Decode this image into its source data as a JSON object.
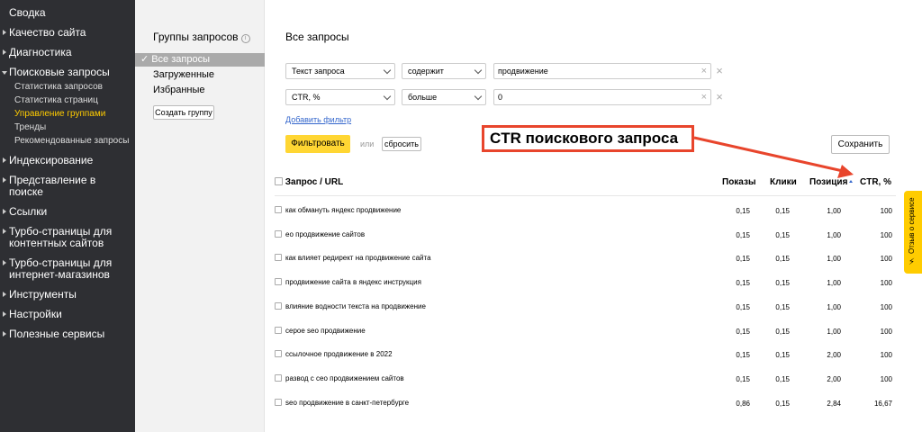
{
  "nav": {
    "items": [
      {
        "label": "Сводка",
        "arrow": false
      },
      {
        "label": "Качество сайта",
        "arrow": true
      },
      {
        "label": "Диагностика",
        "arrow": true
      },
      {
        "label": "Поисковые запросы",
        "arrow": true,
        "open": true
      }
    ],
    "sub_items": [
      {
        "label": "Статистика запросов",
        "active": false
      },
      {
        "label": "Статистика страниц",
        "active": false
      },
      {
        "label": "Управление группами",
        "active": true
      },
      {
        "label": "Тренды",
        "active": false
      },
      {
        "label": "Рекомендованные запросы",
        "active": false
      }
    ],
    "items_after": [
      {
        "label": "Индексирование"
      },
      {
        "label": "Представление в поиске"
      },
      {
        "label": "Ссылки"
      },
      {
        "label": "Турбо-страницы для контентных сайтов"
      },
      {
        "label": "Турбо-страницы для интернет-магазинов"
      },
      {
        "label": "Инструменты"
      },
      {
        "label": "Настройки"
      },
      {
        "label": "Полезные сервисы"
      }
    ]
  },
  "groups": {
    "title": "Группы запросов",
    "info_icon": "i",
    "items": [
      {
        "label": "Все запросы",
        "active": true
      },
      {
        "label": "Загруженные",
        "active": false
      },
      {
        "label": "Избранные",
        "active": false
      }
    ],
    "create_button": "Создать группу"
  },
  "main": {
    "title": "Все запросы",
    "filters": [
      {
        "field": "Текст запроса",
        "operator": "содержит",
        "value": "продвижение"
      },
      {
        "field": "CTR, %",
        "operator": "больше",
        "value": "0"
      }
    ],
    "add_filter": "Добавить фильтр",
    "apply_button": "Фильтровать",
    "or_label": "или",
    "reset_button": "сбросить",
    "save_button": "Сохранить"
  },
  "table": {
    "columns": {
      "query": "Запрос / URL",
      "shows": "Показы",
      "clicks": "Клики",
      "position": "Позиция",
      "ctr": "CTR, %"
    },
    "rows": [
      {
        "query": "как обмануть яндекс продвижение",
        "shows": "0,15",
        "clicks": "0,15",
        "position": "1,00",
        "ctr": "100"
      },
      {
        "query": "ео продвижение сайтов",
        "shows": "0,15",
        "clicks": "0,15",
        "position": "1,00",
        "ctr": "100"
      },
      {
        "query": "как влияет редирект на продвижение сайта",
        "shows": "0,15",
        "clicks": "0,15",
        "position": "1,00",
        "ctr": "100"
      },
      {
        "query": "продвижение сайта в яндекс инструкция",
        "shows": "0,15",
        "clicks": "0,15",
        "position": "1,00",
        "ctr": "100"
      },
      {
        "query": "влияние водности текста на продвижение",
        "shows": "0,15",
        "clicks": "0,15",
        "position": "1,00",
        "ctr": "100"
      },
      {
        "query": "серое seo продвижение",
        "shows": "0,15",
        "clicks": "0,15",
        "position": "1,00",
        "ctr": "100"
      },
      {
        "query": "ссылочное продвижение в 2022",
        "shows": "0,15",
        "clicks": "0,15",
        "position": "2,00",
        "ctr": "100"
      },
      {
        "query": "развод с сео продвижением сайтов",
        "shows": "0,15",
        "clicks": "0,15",
        "position": "2,00",
        "ctr": "100"
      },
      {
        "query": "seo продвижение в санкт-петербурге",
        "shows": "0,86",
        "clicks": "0,15",
        "position": "2,84",
        "ctr": "16,67"
      }
    ]
  },
  "annotation": {
    "text": "CTR поискового запроса",
    "color": "#e8452c"
  },
  "feedback": {
    "label": "Отзыв о сервисе",
    "color": "#ffcc00"
  }
}
